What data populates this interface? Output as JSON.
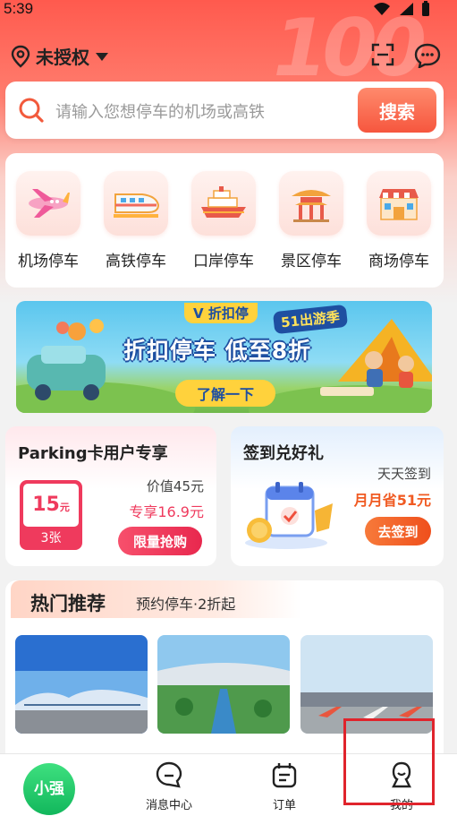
{
  "status_bar": {
    "time": "5:39"
  },
  "header": {
    "location_label": "未授权"
  },
  "search": {
    "placeholder": "请输入您想停车的机场或高铁",
    "button_label": "搜索"
  },
  "categories": [
    {
      "label": "机场停车",
      "icon": "airplane-icon"
    },
    {
      "label": "高铁停车",
      "icon": "train-icon"
    },
    {
      "label": "口岸停车",
      "icon": "ship-icon"
    },
    {
      "label": "景区停车",
      "icon": "pavilion-icon"
    },
    {
      "label": "商场停车",
      "icon": "mall-icon"
    }
  ],
  "banner": {
    "tag": "V 折扣停",
    "promo": "51出游季",
    "title": "折扣停车 低至8折",
    "button_label": "了解一下"
  },
  "parking_card": {
    "title": "Parking卡用户专享",
    "coupon_value": "15",
    "coupon_unit": "元",
    "coupon_count": "3张",
    "value_text": "价值45元",
    "price_text": "专享16.9元",
    "button_label": "限量抢购"
  },
  "checkin_card": {
    "title": "签到兑好礼",
    "sub_text": "天天签到",
    "save_text": "月月省51元",
    "button_label": "去签到"
  },
  "hot": {
    "title": "热门推荐",
    "subtitle": "预约停车·2折起"
  },
  "tabbar": {
    "home_label": "小强",
    "messages_label": "消息中心",
    "orders_label": "订单",
    "mine_label": "我的"
  },
  "colors": {
    "brand_red": "#f6563e",
    "accent_pink": "#ef3a5d",
    "accent_orange": "#f05a22",
    "tab_green": "#12b75c",
    "highlight": "#e0242c"
  }
}
